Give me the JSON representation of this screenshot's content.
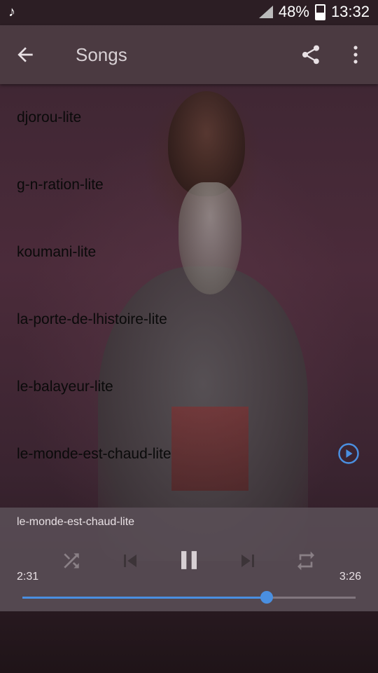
{
  "status_bar": {
    "battery_percent": "48%",
    "time": "13:32",
    "notification_icon": "music-note-icon"
  },
  "app_bar": {
    "title": "Songs",
    "back_icon": "arrow-back-icon",
    "share_icon": "share-icon",
    "more_icon": "more-vertical-icon"
  },
  "songs": [
    {
      "label": "djorou-lite",
      "playing": false
    },
    {
      "label": "g-n-ration-lite",
      "playing": false
    },
    {
      "label": "koumani-lite",
      "playing": false
    },
    {
      "label": "la-porte-de-lhistoire-lite",
      "playing": false
    },
    {
      "label": "le-balayeur-lite",
      "playing": false
    },
    {
      "label": "le-monde-est-chaud-lite",
      "playing": true
    }
  ],
  "player": {
    "now_playing": "le-monde-est-chaud-lite",
    "current_time": "2:31",
    "total_time": "3:26",
    "progress_fraction": 0.733,
    "state": "playing"
  },
  "colors": {
    "accent": "#4a8fe0",
    "app_bar": "#4c3c42",
    "player_bg": "#5a4e56"
  }
}
